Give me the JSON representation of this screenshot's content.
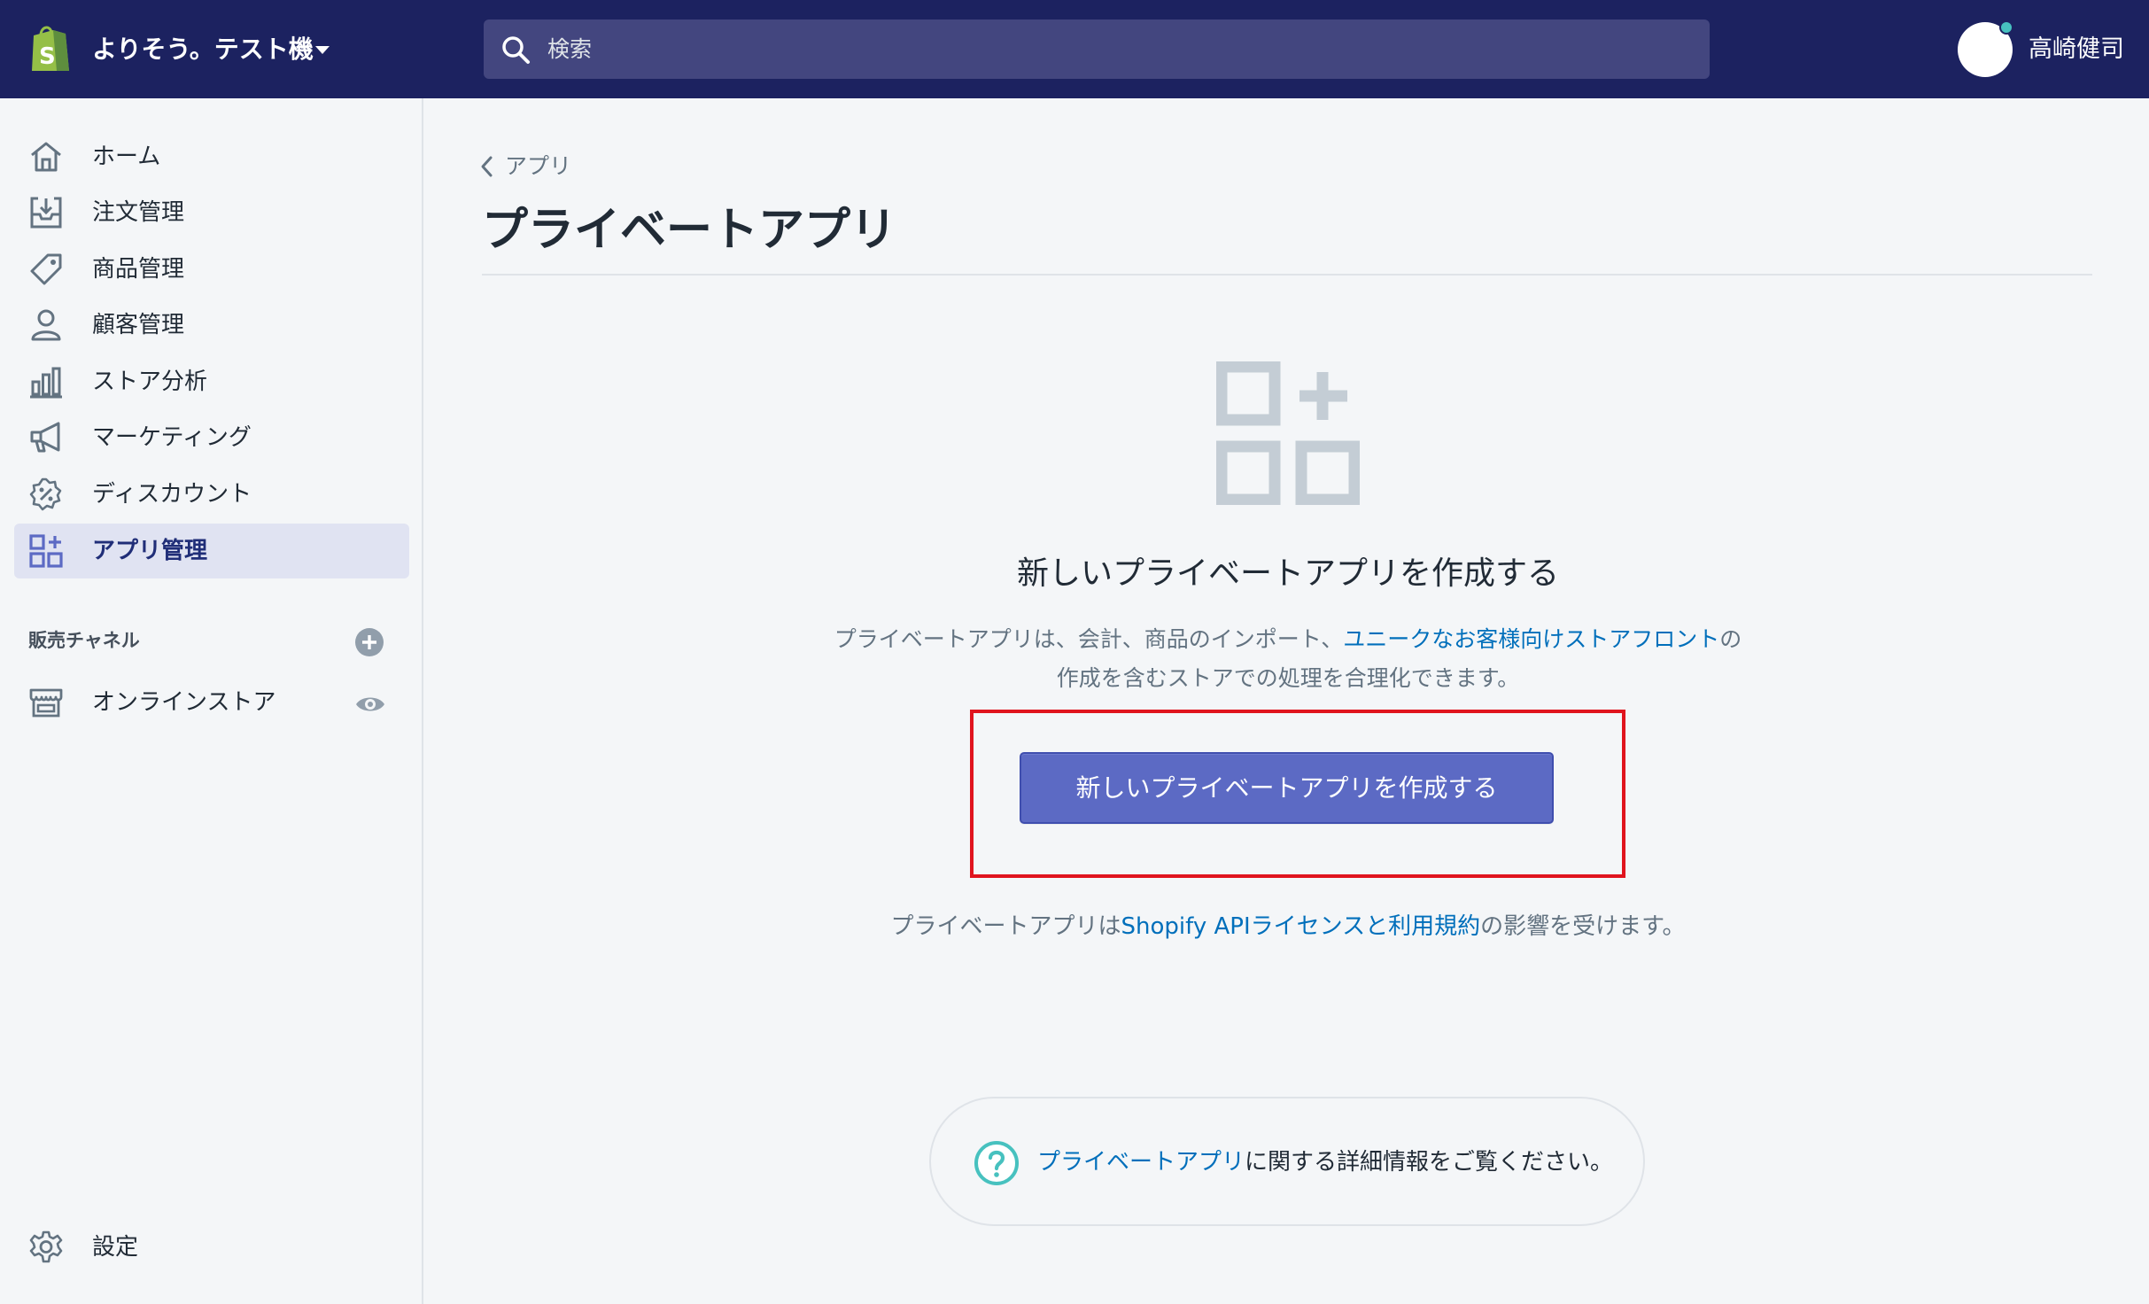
{
  "header": {
    "store_name": "よりそう。テスト機",
    "search_placeholder": "検索",
    "user_name": "高崎健司"
  },
  "sidebar": {
    "items": [
      {
        "label": "ホーム",
        "icon": "home-icon"
      },
      {
        "label": "注文管理",
        "icon": "orders-icon"
      },
      {
        "label": "商品管理",
        "icon": "tag-icon"
      },
      {
        "label": "顧客管理",
        "icon": "customer-icon"
      },
      {
        "label": "ストア分析",
        "icon": "analytics-icon"
      },
      {
        "label": "マーケティング",
        "icon": "megaphone-icon"
      },
      {
        "label": "ディスカウント",
        "icon": "discount-icon"
      },
      {
        "label": "アプリ管理",
        "icon": "apps-icon",
        "active": true
      }
    ],
    "channels_title": "販売チャネル",
    "channels": [
      {
        "label": "オンラインストア",
        "icon": "store-icon"
      }
    ],
    "settings_label": "設定"
  },
  "main": {
    "breadcrumb": "アプリ",
    "title": "プライベートアプリ",
    "empty_state": {
      "heading": "新しいプライベートアプリを作成する",
      "desc_prefix": "プライベートアプリは、会計、商品のインポート、",
      "desc_link": "ユニークなお客様向けストアフロント",
      "desc_suffix_line1": "の",
      "desc_line2": "作成を含むストアでの処理を合理化できます。",
      "button_label": "新しいプライベートアプリを作成する",
      "terms_prefix": "プライベートアプリは",
      "terms_link": "Shopify APIライセンスと利用規約",
      "terms_suffix": "の影響を受けます。"
    },
    "help": {
      "link": "プライベートアプリ",
      "text": "に関する詳細情報をご覧ください。"
    }
  },
  "colors": {
    "topbar": "#1c2260",
    "accent": "#5c6ac4",
    "link": "#006fbb",
    "highlight": "#e0141e",
    "help_icon": "#47c1bf"
  }
}
